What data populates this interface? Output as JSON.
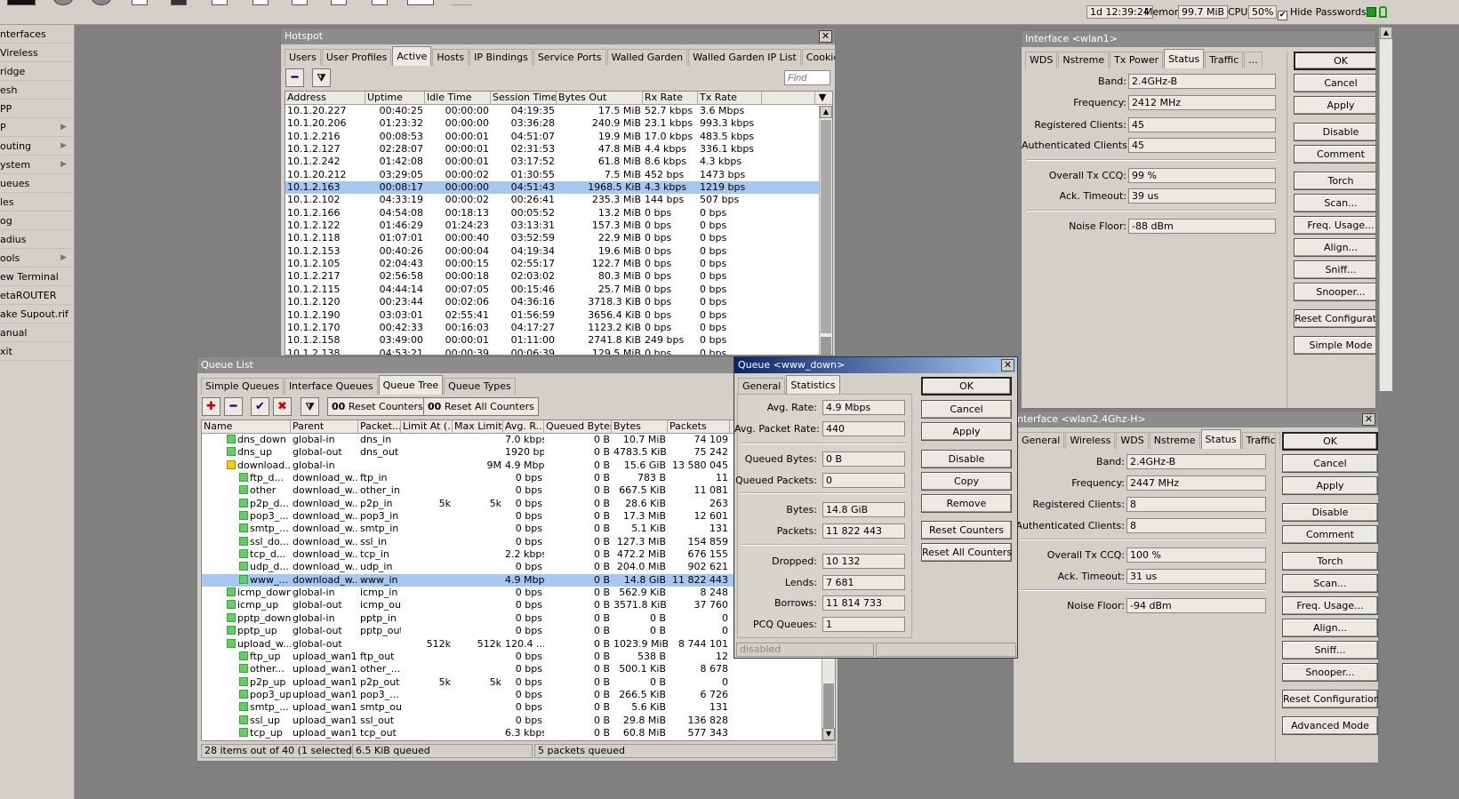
{
  "topbar": {
    "uptime": "1d 12:39:24",
    "memory_label": "Memory:",
    "memory": "99.7 MiB",
    "cpu_label": "CPU:",
    "cpu": "50%",
    "hide_passwords": "Hide Passwords"
  },
  "sidebar": {
    "items": [
      {
        "label": "nterfaces",
        "sub": false
      },
      {
        "label": "Vireless",
        "sub": false
      },
      {
        "label": "ridge",
        "sub": false
      },
      {
        "label": "esh",
        "sub": false
      },
      {
        "label": "PP",
        "sub": false
      },
      {
        "label": "P",
        "sub": true
      },
      {
        "label": "outing",
        "sub": true
      },
      {
        "label": "ystem",
        "sub": true
      },
      {
        "label": "ueues",
        "sub": false
      },
      {
        "label": "les",
        "sub": false
      },
      {
        "label": "og",
        "sub": false
      },
      {
        "label": "adius",
        "sub": false
      },
      {
        "label": "ools",
        "sub": true
      },
      {
        "label": "ew Terminal",
        "sub": false
      },
      {
        "label": "etaROUTER",
        "sub": false
      },
      {
        "label": "ake Supout.rif",
        "sub": false
      },
      {
        "label": "anual",
        "sub": false
      },
      {
        "label": "xit",
        "sub": false
      }
    ]
  },
  "hotspot": {
    "title": "Hotspot",
    "tabs": [
      "Users",
      "User Profiles",
      "Active",
      "Hosts",
      "IP Bindings",
      "Service Ports",
      "Walled Garden",
      "Walled Garden IP List",
      "Cookies",
      "..."
    ],
    "active_tab": 2,
    "find_placeholder": "Find",
    "columns": [
      "Address",
      "Uptime",
      "Idle Time",
      "Session Time ...",
      "Bytes Out",
      "Rx Rate",
      "Tx Rate"
    ],
    "rows": [
      [
        "10.1.20.227",
        "00:40:25",
        "00:00:00",
        "04:19:35",
        "17.5 MiB",
        "52.7 kbps",
        "3.6 Mbps"
      ],
      [
        "10.1.20.206",
        "01:23:32",
        "00:00:00",
        "03:36:28",
        "240.9 MiB",
        "23.1 kbps",
        "993.3 kbps"
      ],
      [
        "10.1.2.216",
        "00:08:53",
        "00:00:01",
        "04:51:07",
        "19.9 MiB",
        "17.0 kbps",
        "483.5 kbps"
      ],
      [
        "10.1.2.127",
        "02:28:07",
        "00:00:01",
        "02:31:53",
        "47.8 MiB",
        "4.4 kbps",
        "336.1 kbps"
      ],
      [
        "10.1.2.242",
        "01:42:08",
        "00:00:01",
        "03:17:52",
        "61.8 MiB",
        "8.6 kbps",
        "4.3 kbps"
      ],
      [
        "10.1.20.212",
        "03:29:05",
        "00:00:02",
        "01:30:55",
        "7.5 MiB",
        "452 bps",
        "1473 bps"
      ],
      [
        "10.1.2.163",
        "00:08:17",
        "00:00:00",
        "04:51:43",
        "1968.5 KiB",
        "4.3 kbps",
        "1219 bps"
      ],
      [
        "10.1.2.102",
        "04:33:19",
        "00:00:02",
        "00:26:41",
        "235.3 MiB",
        "144 bps",
        "507 bps"
      ],
      [
        "10.1.2.166",
        "04:54:08",
        "00:18:13",
        "00:05:52",
        "13.2 MiB",
        "0 bps",
        "0 bps"
      ],
      [
        "10.1.2.122",
        "01:46:29",
        "01:24:23",
        "03:13:31",
        "157.3 MiB",
        "0 bps",
        "0 bps"
      ],
      [
        "10.1.2.118",
        "01:07:01",
        "00:00:40",
        "03:52:59",
        "22.9 MiB",
        "0 bps",
        "0 bps"
      ],
      [
        "10.1.2.153",
        "00:40:26",
        "00:00:04",
        "04:19:34",
        "19.6 MiB",
        "0 bps",
        "0 bps"
      ],
      [
        "10.1.2.105",
        "02:04:43",
        "00:00:15",
        "02:55:17",
        "122.7 MiB",
        "0 bps",
        "0 bps"
      ],
      [
        "10.1.2.217",
        "02:56:58",
        "00:00:18",
        "02:03:02",
        "80.3 MiB",
        "0 bps",
        "0 bps"
      ],
      [
        "10.1.2.115",
        "04:44:14",
        "00:07:05",
        "00:15:46",
        "25.7 MiB",
        "0 bps",
        "0 bps"
      ],
      [
        "10.1.2.120",
        "00:23:44",
        "00:02:06",
        "04:36:16",
        "3718.3 KiB",
        "0 bps",
        "0 bps"
      ],
      [
        "10.1.2.190",
        "03:03:01",
        "02:55:41",
        "01:56:59",
        "3656.4 KiB",
        "0 bps",
        "0 bps"
      ],
      [
        "10.1.2.170",
        "00:42:33",
        "00:16:03",
        "04:17:27",
        "1123.2 KiB",
        "0 bps",
        "0 bps"
      ],
      [
        "10.1.2.158",
        "03:49:00",
        "00:00:01",
        "01:11:00",
        "2741.8 KiB",
        "249 bps",
        "0 bps"
      ],
      [
        "10.1.2.138",
        "04:53:21",
        "00:00:39",
        "00:06:39",
        "129.5 MiB",
        "0 bps",
        "0 bps"
      ]
    ]
  },
  "wlan1": {
    "title": "Interface <wlan1>",
    "tabs": [
      "WDS",
      "Nstreme",
      "Tx Power",
      "Status",
      "Traffic",
      "..."
    ],
    "active_tab": 3,
    "fields": [
      {
        "label": "Band:",
        "value": "2.4GHz-B"
      },
      {
        "label": "Frequency:",
        "value": "2412 MHz"
      },
      {
        "label": "Registered Clients:",
        "value": "45"
      },
      {
        "label": "Authenticated Clients:",
        "value": "45"
      },
      {
        "label": "Overall Tx CCQ:",
        "value": "99 %"
      },
      {
        "label": "Ack. Timeout:",
        "value": "39 us"
      },
      {
        "label": "Noise Floor:",
        "value": "-88 dBm"
      }
    ],
    "buttons": [
      "OK",
      "Cancel",
      "Apply",
      "Disable",
      "Comment",
      "Torch",
      "Scan...",
      "Freq. Usage...",
      "Align...",
      "Sniff...",
      "Snooper...",
      "Reset Configuration",
      "Simple Mode"
    ]
  },
  "wlan2": {
    "title": "nterface <wlan2.4Ghz-H>",
    "tabs": [
      "General",
      "Wireless",
      "WDS",
      "Nstreme",
      "Status",
      "Traffic"
    ],
    "active_tab": 4,
    "fields": [
      {
        "label": "Band:",
        "value": "2.4GHz-B"
      },
      {
        "label": "Frequency:",
        "value": "2447 MHz"
      },
      {
        "label": "Registered Clients:",
        "value": "8"
      },
      {
        "label": "Authenticated Clients:",
        "value": "8"
      },
      {
        "label": "Overall Tx CCQ:",
        "value": "100 %"
      },
      {
        "label": "Ack. Timeout:",
        "value": "31 us"
      },
      {
        "label": "Noise Floor:",
        "value": "-94 dBm"
      }
    ],
    "buttons": [
      "OK",
      "Cancel",
      "Apply",
      "Disable",
      "Comment",
      "Torch",
      "Scan...",
      "Freq. Usage...",
      "Align...",
      "Sniff...",
      "Snooper...",
      "Reset Configuration",
      "Advanced Mode"
    ]
  },
  "queue_list": {
    "title": "Queue List",
    "tabs": [
      "Simple Queues",
      "Interface Queues",
      "Queue Tree",
      "Queue Types"
    ],
    "active_tab": 2,
    "toolbar": {
      "reset_counters": "Reset Counters",
      "reset_all_counters": "Reset All Counters",
      "oo": "00"
    },
    "columns": [
      "Name",
      "Parent",
      "Packet...",
      "Limit At (...",
      "Max Limit...",
      "Avg. R...",
      "Queued Bytes",
      "Bytes",
      "Packets"
    ],
    "rows": [
      {
        "indent": 0,
        "icon": "g",
        "name": "dns_down",
        "parent": "global-in",
        "packet": "dns_in",
        "limit": "",
        "max": "",
        "avg": "7.0 kbps",
        "queued": "0 B",
        "bytes": "10.7 MiB",
        "packets": "74 109"
      },
      {
        "indent": 0,
        "icon": "g",
        "name": "dns_up",
        "parent": "global-out",
        "packet": "dns_out",
        "limit": "",
        "max": "",
        "avg": "1920 bps",
        "queued": "0 B",
        "bytes": "4783.5 KiB",
        "packets": "75 242"
      },
      {
        "indent": 0,
        "icon": "y",
        "name": "download...",
        "parent": "global-in",
        "packet": "",
        "limit": "",
        "max": "9M",
        "avg": "4.9 Mbps",
        "queued": "0 B",
        "bytes": "15.6 GiB",
        "packets": "13 580 045"
      },
      {
        "indent": 1,
        "icon": "g",
        "name": "ftp_d...",
        "parent": "download_w...",
        "packet": "ftp_in",
        "limit": "",
        "max": "",
        "avg": "0 bps",
        "queued": "0 B",
        "bytes": "783 B",
        "packets": "11"
      },
      {
        "indent": 1,
        "icon": "g",
        "name": "other",
        "parent": "download_w...",
        "packet": "other_in",
        "limit": "",
        "max": "",
        "avg": "0 bps",
        "queued": "0 B",
        "bytes": "667.5 KiB",
        "packets": "11 081"
      },
      {
        "indent": 1,
        "icon": "g",
        "name": "p2p_d...",
        "parent": "download_w...",
        "packet": "p2p_in",
        "limit": "5k",
        "max": "5k",
        "avg": "0 bps",
        "queued": "0 B",
        "bytes": "28.6 KiB",
        "packets": "263"
      },
      {
        "indent": 1,
        "icon": "g",
        "name": "pop3_...",
        "parent": "download_w...",
        "packet": "pop3_in",
        "limit": "",
        "max": "",
        "avg": "0 bps",
        "queued": "0 B",
        "bytes": "17.3 MiB",
        "packets": "12 601"
      },
      {
        "indent": 1,
        "icon": "g",
        "name": "smtp_...",
        "parent": "download_w...",
        "packet": "smtp_in",
        "limit": "",
        "max": "",
        "avg": "0 bps",
        "queued": "0 B",
        "bytes": "5.1 KiB",
        "packets": "131"
      },
      {
        "indent": 1,
        "icon": "g",
        "name": "ssl_do...",
        "parent": "download_w...",
        "packet": "ssl_in",
        "limit": "",
        "max": "",
        "avg": "0 bps",
        "queued": "0 B",
        "bytes": "127.3 MiB",
        "packets": "154 859"
      },
      {
        "indent": 1,
        "icon": "g",
        "name": "tcp_d...",
        "parent": "download_w...",
        "packet": "tcp_in",
        "limit": "",
        "max": "",
        "avg": "2.2 kbps",
        "queued": "0 B",
        "bytes": "472.2 MiB",
        "packets": "676 155"
      },
      {
        "indent": 1,
        "icon": "g",
        "name": "udp_d...",
        "parent": "download_w...",
        "packet": "udp_in",
        "limit": "",
        "max": "",
        "avg": "0 bps",
        "queued": "0 B",
        "bytes": "204.0 MiB",
        "packets": "902 621"
      },
      {
        "indent": 1,
        "icon": "g",
        "name": "www_...",
        "parent": "download_w...",
        "packet": "www_in",
        "limit": "",
        "max": "",
        "avg": "4.9 Mbps",
        "queued": "0 B",
        "bytes": "14.8 GiB",
        "packets": "11 822 443",
        "selected": true
      },
      {
        "indent": 0,
        "icon": "g",
        "name": "icmp_down",
        "parent": "global-in",
        "packet": "icmp_in",
        "limit": "",
        "max": "",
        "avg": "0 bps",
        "queued": "0 B",
        "bytes": "562.9 KiB",
        "packets": "8 248"
      },
      {
        "indent": 0,
        "icon": "g",
        "name": "icmp_up",
        "parent": "global-out",
        "packet": "icmp_out",
        "limit": "",
        "max": "",
        "avg": "0 bps",
        "queued": "0 B",
        "bytes": "3571.8 KiB",
        "packets": "37 760"
      },
      {
        "indent": 0,
        "icon": "g",
        "name": "pptp_down",
        "parent": "global-in",
        "packet": "pptp_in",
        "limit": "",
        "max": "",
        "avg": "0 bps",
        "queued": "0 B",
        "bytes": "0 B",
        "packets": "0"
      },
      {
        "indent": 0,
        "icon": "g",
        "name": "pptp_up",
        "parent": "global-out",
        "packet": "pptp_out",
        "limit": "",
        "max": "",
        "avg": "0 bps",
        "queued": "0 B",
        "bytes": "0 B",
        "packets": "0"
      },
      {
        "indent": 0,
        "icon": "g",
        "name": "upload_w...",
        "parent": "global-out",
        "packet": "",
        "limit": "512k",
        "max": "512k",
        "avg": "120.4 ...",
        "queued": "0 B",
        "bytes": "1023.9 MiB",
        "packets": "8 744 101"
      },
      {
        "indent": 1,
        "icon": "g",
        "name": "ftp_up",
        "parent": "upload_wan1",
        "packet": "ftp_out",
        "limit": "",
        "max": "",
        "avg": "0 bps",
        "queued": "0 B",
        "bytes": "538 B",
        "packets": "12"
      },
      {
        "indent": 1,
        "icon": "g",
        "name": "other...",
        "parent": "upload_wan1",
        "packet": "other_...",
        "limit": "",
        "max": "",
        "avg": "0 bps",
        "queued": "0 B",
        "bytes": "500.1 KiB",
        "packets": "8 678"
      },
      {
        "indent": 1,
        "icon": "g",
        "name": "p2p_up",
        "parent": "upload_wan1",
        "packet": "p2p_out",
        "limit": "5k",
        "max": "5k",
        "avg": "0 bps",
        "queued": "0 B",
        "bytes": "0 B",
        "packets": "0"
      },
      {
        "indent": 1,
        "icon": "g",
        "name": "pop3_up",
        "parent": "upload_wan1",
        "packet": "pop3_...",
        "limit": "",
        "max": "",
        "avg": "0 bps",
        "queued": "0 B",
        "bytes": "266.5 KiB",
        "packets": "6 726"
      },
      {
        "indent": 1,
        "icon": "g",
        "name": "smtp_...",
        "parent": "upload_wan1",
        "packet": "smtp_out",
        "limit": "",
        "max": "",
        "avg": "0 bps",
        "queued": "0 B",
        "bytes": "5.6 KiB",
        "packets": "131"
      },
      {
        "indent": 1,
        "icon": "g",
        "name": "ssl_up",
        "parent": "upload_wan1",
        "packet": "ssl_out",
        "limit": "",
        "max": "",
        "avg": "0 bps",
        "queued": "0 B",
        "bytes": "29.8 MiB",
        "packets": "136 828"
      },
      {
        "indent": 1,
        "icon": "g",
        "name": "tcp_up",
        "parent": "upload_wan1",
        "packet": "tcp_out",
        "limit": "",
        "max": "",
        "avg": "6.3 kbps",
        "queued": "0 B",
        "bytes": "60.8 MiB",
        "packets": "577 343"
      }
    ],
    "status": {
      "items": "28 items out of 40 (1 selected)",
      "queued": "6.5 KiB queued",
      "packets": "5 packets queued"
    }
  },
  "queue_dialog": {
    "title": "Queue <www_down>",
    "tabs": [
      "General",
      "Statistics"
    ],
    "active_tab": 1,
    "fields": [
      {
        "label": "Avg. Rate:",
        "value": "4.9 Mbps"
      },
      {
        "label": "Avg. Packet Rate:",
        "value": "440"
      },
      {
        "label": "Queued Bytes:",
        "value": "0 B"
      },
      {
        "label": "Queued Packets:",
        "value": "0"
      },
      {
        "label": "Bytes:",
        "value": "14.8 GiB"
      },
      {
        "label": "Packets:",
        "value": "11 822 443"
      },
      {
        "label": "Dropped:",
        "value": "10 132"
      },
      {
        "label": "Lends:",
        "value": "7 681"
      },
      {
        "label": "Borrows:",
        "value": "11 814 733"
      },
      {
        "label": "PCQ Queues:",
        "value": "1"
      }
    ],
    "buttons": [
      "OK",
      "Cancel",
      "Apply",
      "Disable",
      "Copy",
      "Remove",
      "Reset Counters",
      "Reset All Counters"
    ],
    "status": "disabled"
  }
}
